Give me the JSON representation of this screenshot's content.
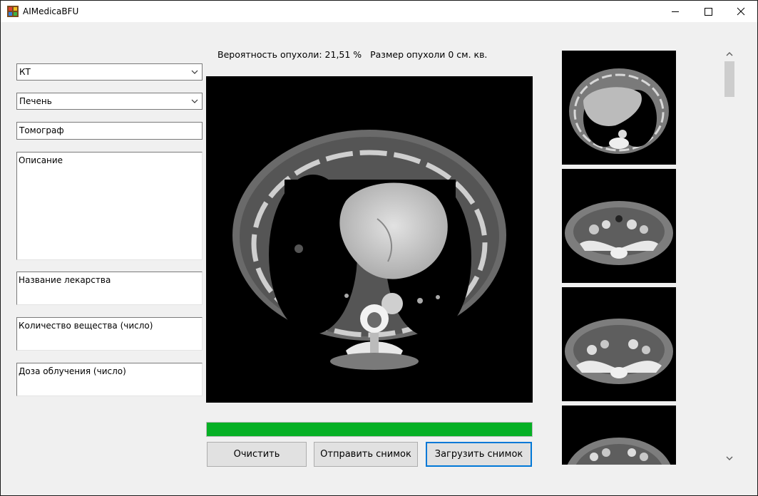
{
  "window": {
    "title": "AIMedicaBFU"
  },
  "form": {
    "modality": "КТ",
    "organ": "Печень",
    "device": "Томограф",
    "description": "Описание",
    "drug_name": "Название лекарства",
    "substance_amount": "Количество вещества (число)",
    "radiation_dose": "Доза облучения (число)"
  },
  "status": {
    "probability_label": "Вероятность опухоли:",
    "probability_value": "21,51 %",
    "size_label": "Размер опухоли",
    "size_value": "0 см. кв."
  },
  "progress": {
    "value": 1.0,
    "color": "#06b025"
  },
  "buttons": {
    "clear": "Очистить",
    "send": "Отправить снимок",
    "load": "Загрузить снимок"
  },
  "thumbnails": [
    "chest-ct-slice",
    "abdomen-ct-slice",
    "pelvis-ct-slice",
    "pelvis-ct-slice"
  ],
  "icons": [
    "app-icon",
    "minimize-icon",
    "maximize-icon",
    "close-icon",
    "chevron-down-icon",
    "scroll-up-icon",
    "scroll-down-icon"
  ],
  "colors": {
    "accent": "#0078d7",
    "progress": "#06b025"
  }
}
